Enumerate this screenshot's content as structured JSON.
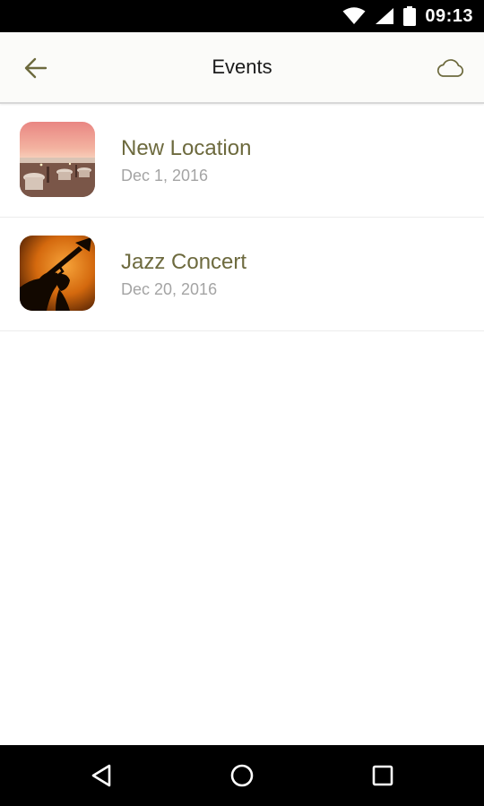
{
  "status_bar": {
    "time": "09:13",
    "icons": [
      "wifi-icon",
      "signal-icon",
      "battery-icon"
    ]
  },
  "app_bar": {
    "title": "Events",
    "back_icon": "arrow-back-icon",
    "action_icon": "cloud-icon"
  },
  "events": [
    {
      "name": "New Location",
      "date": "Dec 1, 2016",
      "image": "sunset-terrace-thumbnail"
    },
    {
      "name": "Jazz Concert",
      "date": "Dec 20, 2016",
      "image": "trumpet-silhouette-thumbnail"
    }
  ],
  "nav_bar": {
    "buttons": [
      "back-triangle-icon",
      "home-circle-icon",
      "recents-square-icon"
    ]
  },
  "colors": {
    "accent": "#6d6a3e",
    "date_text": "#a4a4a4",
    "title_text": "#1b1b1b",
    "app_bar_bg": "#fbfbf9",
    "system_bars": "#000000"
  }
}
